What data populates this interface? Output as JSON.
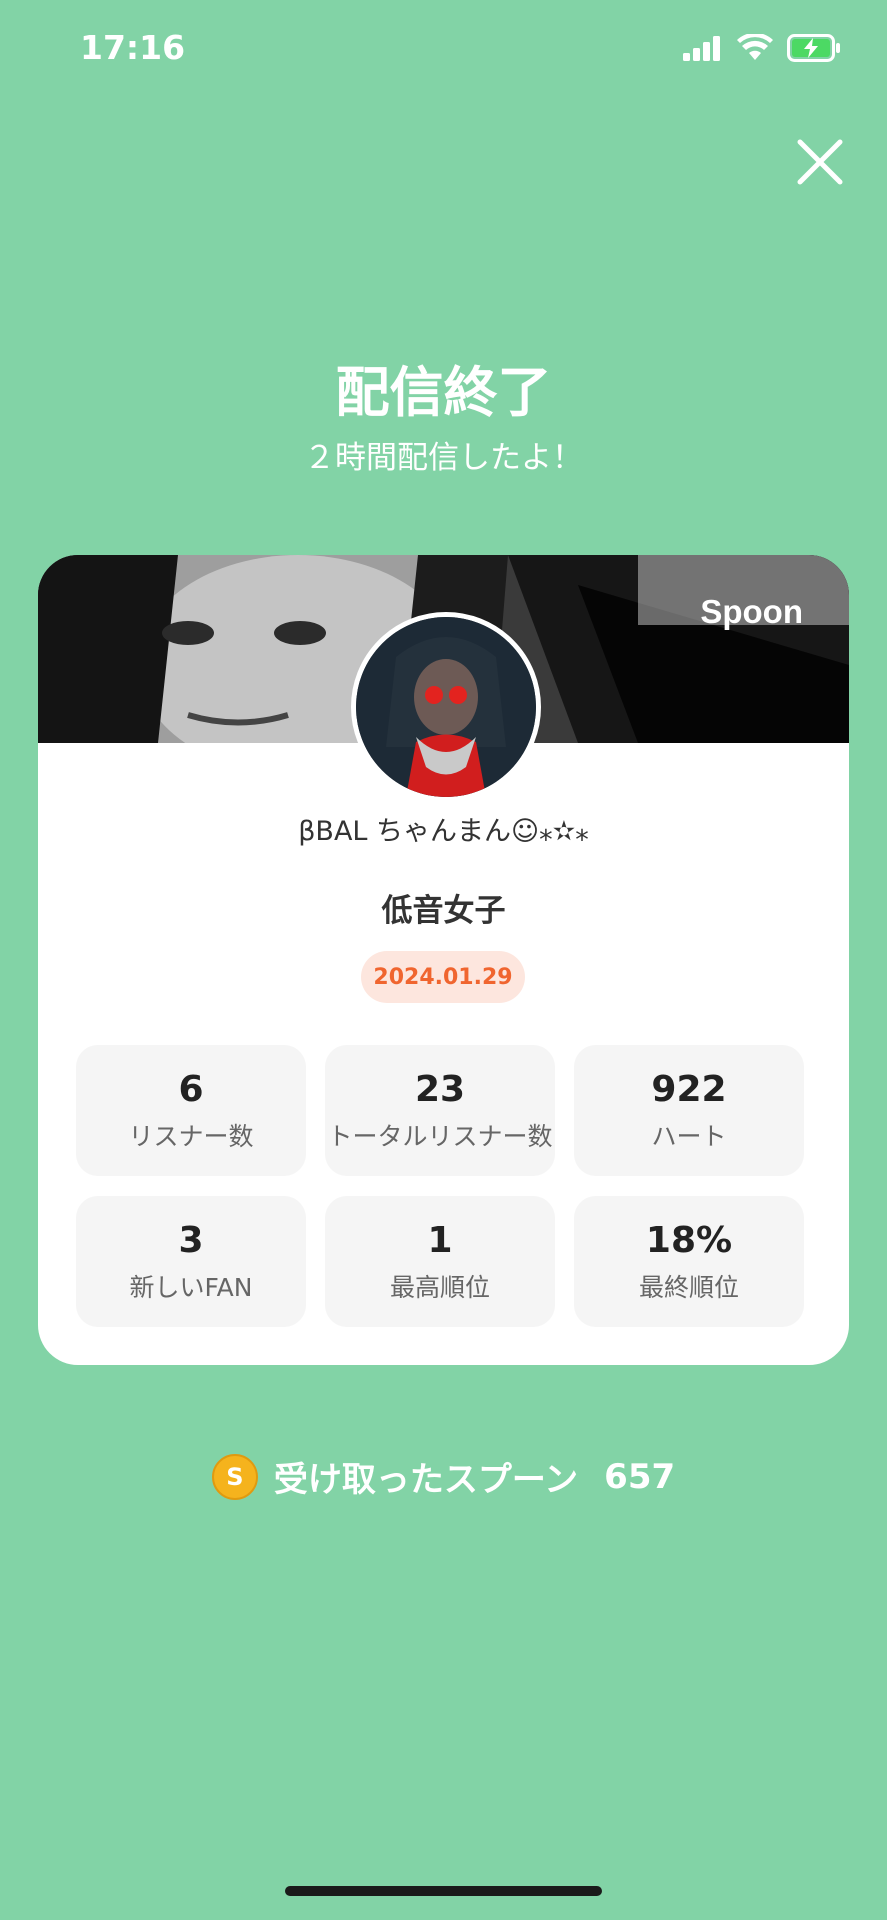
{
  "status_bar": {
    "time": "17:16"
  },
  "header": {
    "title": "配信終了",
    "subtitle": "２時間配信したよ！"
  },
  "card": {
    "brand": "Spoon",
    "username": "βBAL ちゃんまん☺︎⁎✫⁎",
    "stream_title": "低音女子",
    "date": "2024.01.29",
    "stats": [
      {
        "value": "6",
        "label": "リスナー数"
      },
      {
        "value": "23",
        "label": "トータルリスナー数"
      },
      {
        "value": "922",
        "label": "ハート"
      },
      {
        "value": "3",
        "label": "新しいFAN"
      },
      {
        "value": "1",
        "label": "最高順位"
      },
      {
        "value": "18%",
        "label": "最終順位"
      }
    ]
  },
  "spoons": {
    "label": "受け取ったスプーン",
    "count": "657",
    "coin_letter": "S"
  },
  "colors": {
    "background": "#82d3a6",
    "date_badge_bg": "#fde6de",
    "date_badge_text": "#f0652f",
    "coin": "#f5b31d"
  },
  "icons": [
    "signal-icon",
    "wifi-icon",
    "battery-charging-icon",
    "close-icon",
    "spoon-coin-icon"
  ]
}
